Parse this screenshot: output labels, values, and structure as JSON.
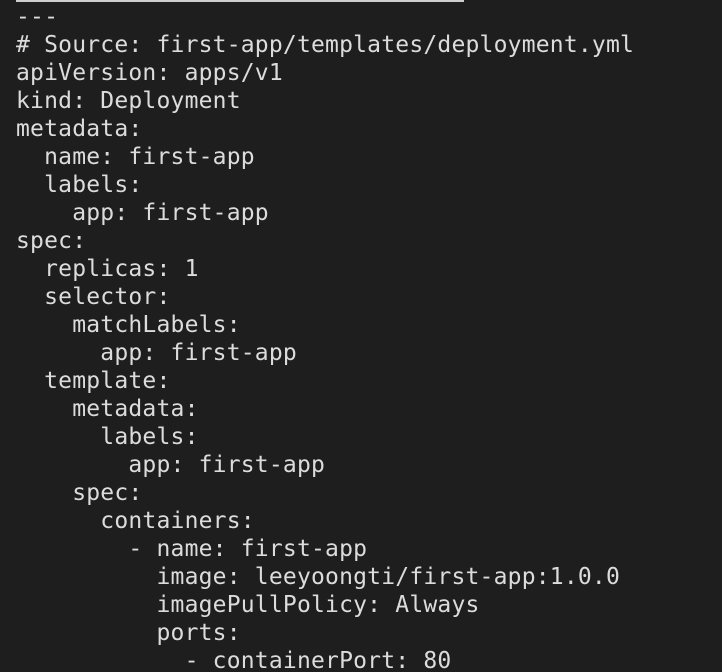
{
  "terminal": {
    "lines": [
      "---",
      "# Source: first-app/templates/deployment.yml",
      "apiVersion: apps/v1",
      "kind: Deployment",
      "metadata:",
      "  name: first-app",
      "  labels:",
      "    app: first-app",
      "spec:",
      "  replicas: 1",
      "  selector:",
      "    matchLabels:",
      "      app: first-app",
      "  template:",
      "    metadata:",
      "      labels:",
      "        app: first-app",
      "    spec:",
      "      containers:",
      "        - name: first-app",
      "          image: leeyoongti/first-app:1.0.0",
      "          imagePullPolicy: Always",
      "          ports:",
      "            - containerPort: 80"
    ]
  },
  "colors": {
    "background": "#1e1e1e",
    "text": "#dcdcdc"
  }
}
